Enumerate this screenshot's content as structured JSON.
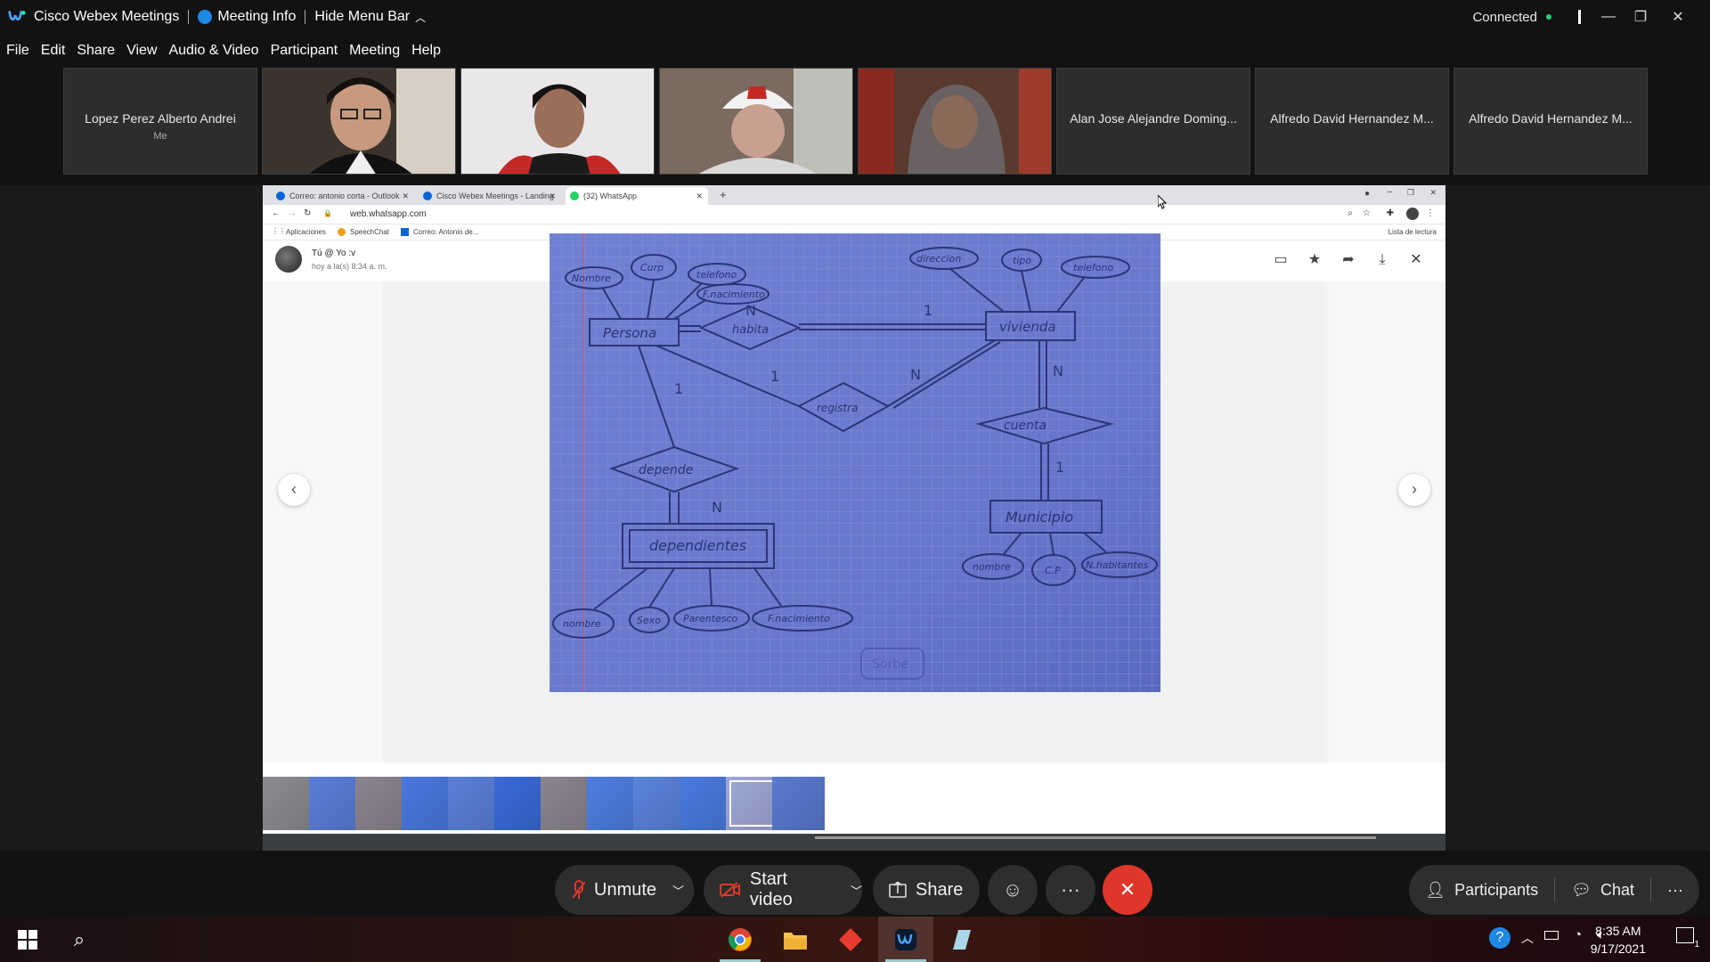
{
  "titlebar": {
    "app_title": "Cisco Webex Meetings",
    "meeting_info": "Meeting Info",
    "hide_menu": "Hide Menu Bar",
    "status": "Connected"
  },
  "menu": [
    "File",
    "Edit",
    "Share",
    "View",
    "Audio & Video",
    "Participant",
    "Meeting",
    "Help"
  ],
  "participants": [
    {
      "name": "Lopez Perez Alberto Andrei",
      "sub": "Me",
      "video": false
    },
    {
      "name": "",
      "sub": "",
      "video": true
    },
    {
      "name": "",
      "sub": "",
      "video": true
    },
    {
      "name": "",
      "sub": "",
      "video": true
    },
    {
      "name": "",
      "sub": "",
      "video": true
    },
    {
      "name": "Alan Jose Alejandre Doming...",
      "sub": "",
      "video": false
    },
    {
      "name": "Alfredo David Hernandez M...",
      "sub": "",
      "video": false
    },
    {
      "name": "Alfredo David Hernandez M...",
      "sub": "",
      "video": false
    }
  ],
  "browser": {
    "tabs": [
      {
        "title": "Correo: antonio corta - Outlook",
        "fav_color": "#0a64d8"
      },
      {
        "title": "Cisco Webex Meetings - Landing",
        "fav_color": "#0a64d8"
      },
      {
        "title": "(32) WhatsApp",
        "fav_color": "#25d366"
      }
    ],
    "url": "web.whatsapp.com",
    "bookmarks": [
      "Aplicaciones",
      "SpeechChat",
      "Correo: Antonio de..."
    ],
    "reading_list": "Lista de lectura"
  },
  "viewer": {
    "sender": "Tú @ Yo :v",
    "time": "hoy a la(s) 8:34 a. m.",
    "diagram_labels": {
      "persona": "Persona",
      "habita": "habita",
      "vivienda": "vivienda",
      "registra": "registra",
      "depende": "depende",
      "dependientes": "dependientes",
      "cuenta": "cuenta",
      "municipio": "Municipio",
      "nombre": "Nombre",
      "curp": "Curp",
      "telefono": "telefono",
      "fnacimiento": "F.nacimiento",
      "direccion": "direccion",
      "tipo": "tipo",
      "telefono2": "telefono",
      "nombre2": "nombre",
      "sexo": "Sexo",
      "parentesco": "Parentesco",
      "fnacimiento2": "F.nacimiento",
      "nombre3": "nombre",
      "cp": "C.P",
      "nhabitantes": "N.habitantes",
      "card_n1": "N",
      "card_1a": "1",
      "card_1b": "1",
      "card_1c": "1",
      "card_n2": "N",
      "card_n3": "N",
      "card_n4": "N",
      "card_1d": "1",
      "signature": "Sorbe"
    },
    "thumb_colors": [
      "#8c8c90",
      "#5a7ed8",
      "#8a8590",
      "#4a78e0",
      "#5a80d8",
      "#3a6ad8",
      "#8a8590",
      "#4e7ee2",
      "#5a84dc",
      "#4a7ae0",
      "#a0a8d8",
      "#5a7ad0"
    ]
  },
  "controls": {
    "unmute": "Unmute",
    "start_video": "Start video",
    "share": "Share",
    "participants": "Participants",
    "chat": "Chat"
  },
  "taskbar": {
    "time": "8:35 AM",
    "date": "9/17/2021",
    "notifications": "1"
  },
  "colors": {
    "accent_blue": "#1e88e5",
    "end_red": "#e0362a",
    "mute_red": "#e0362a",
    "connected_green": "#2ecc71"
  }
}
